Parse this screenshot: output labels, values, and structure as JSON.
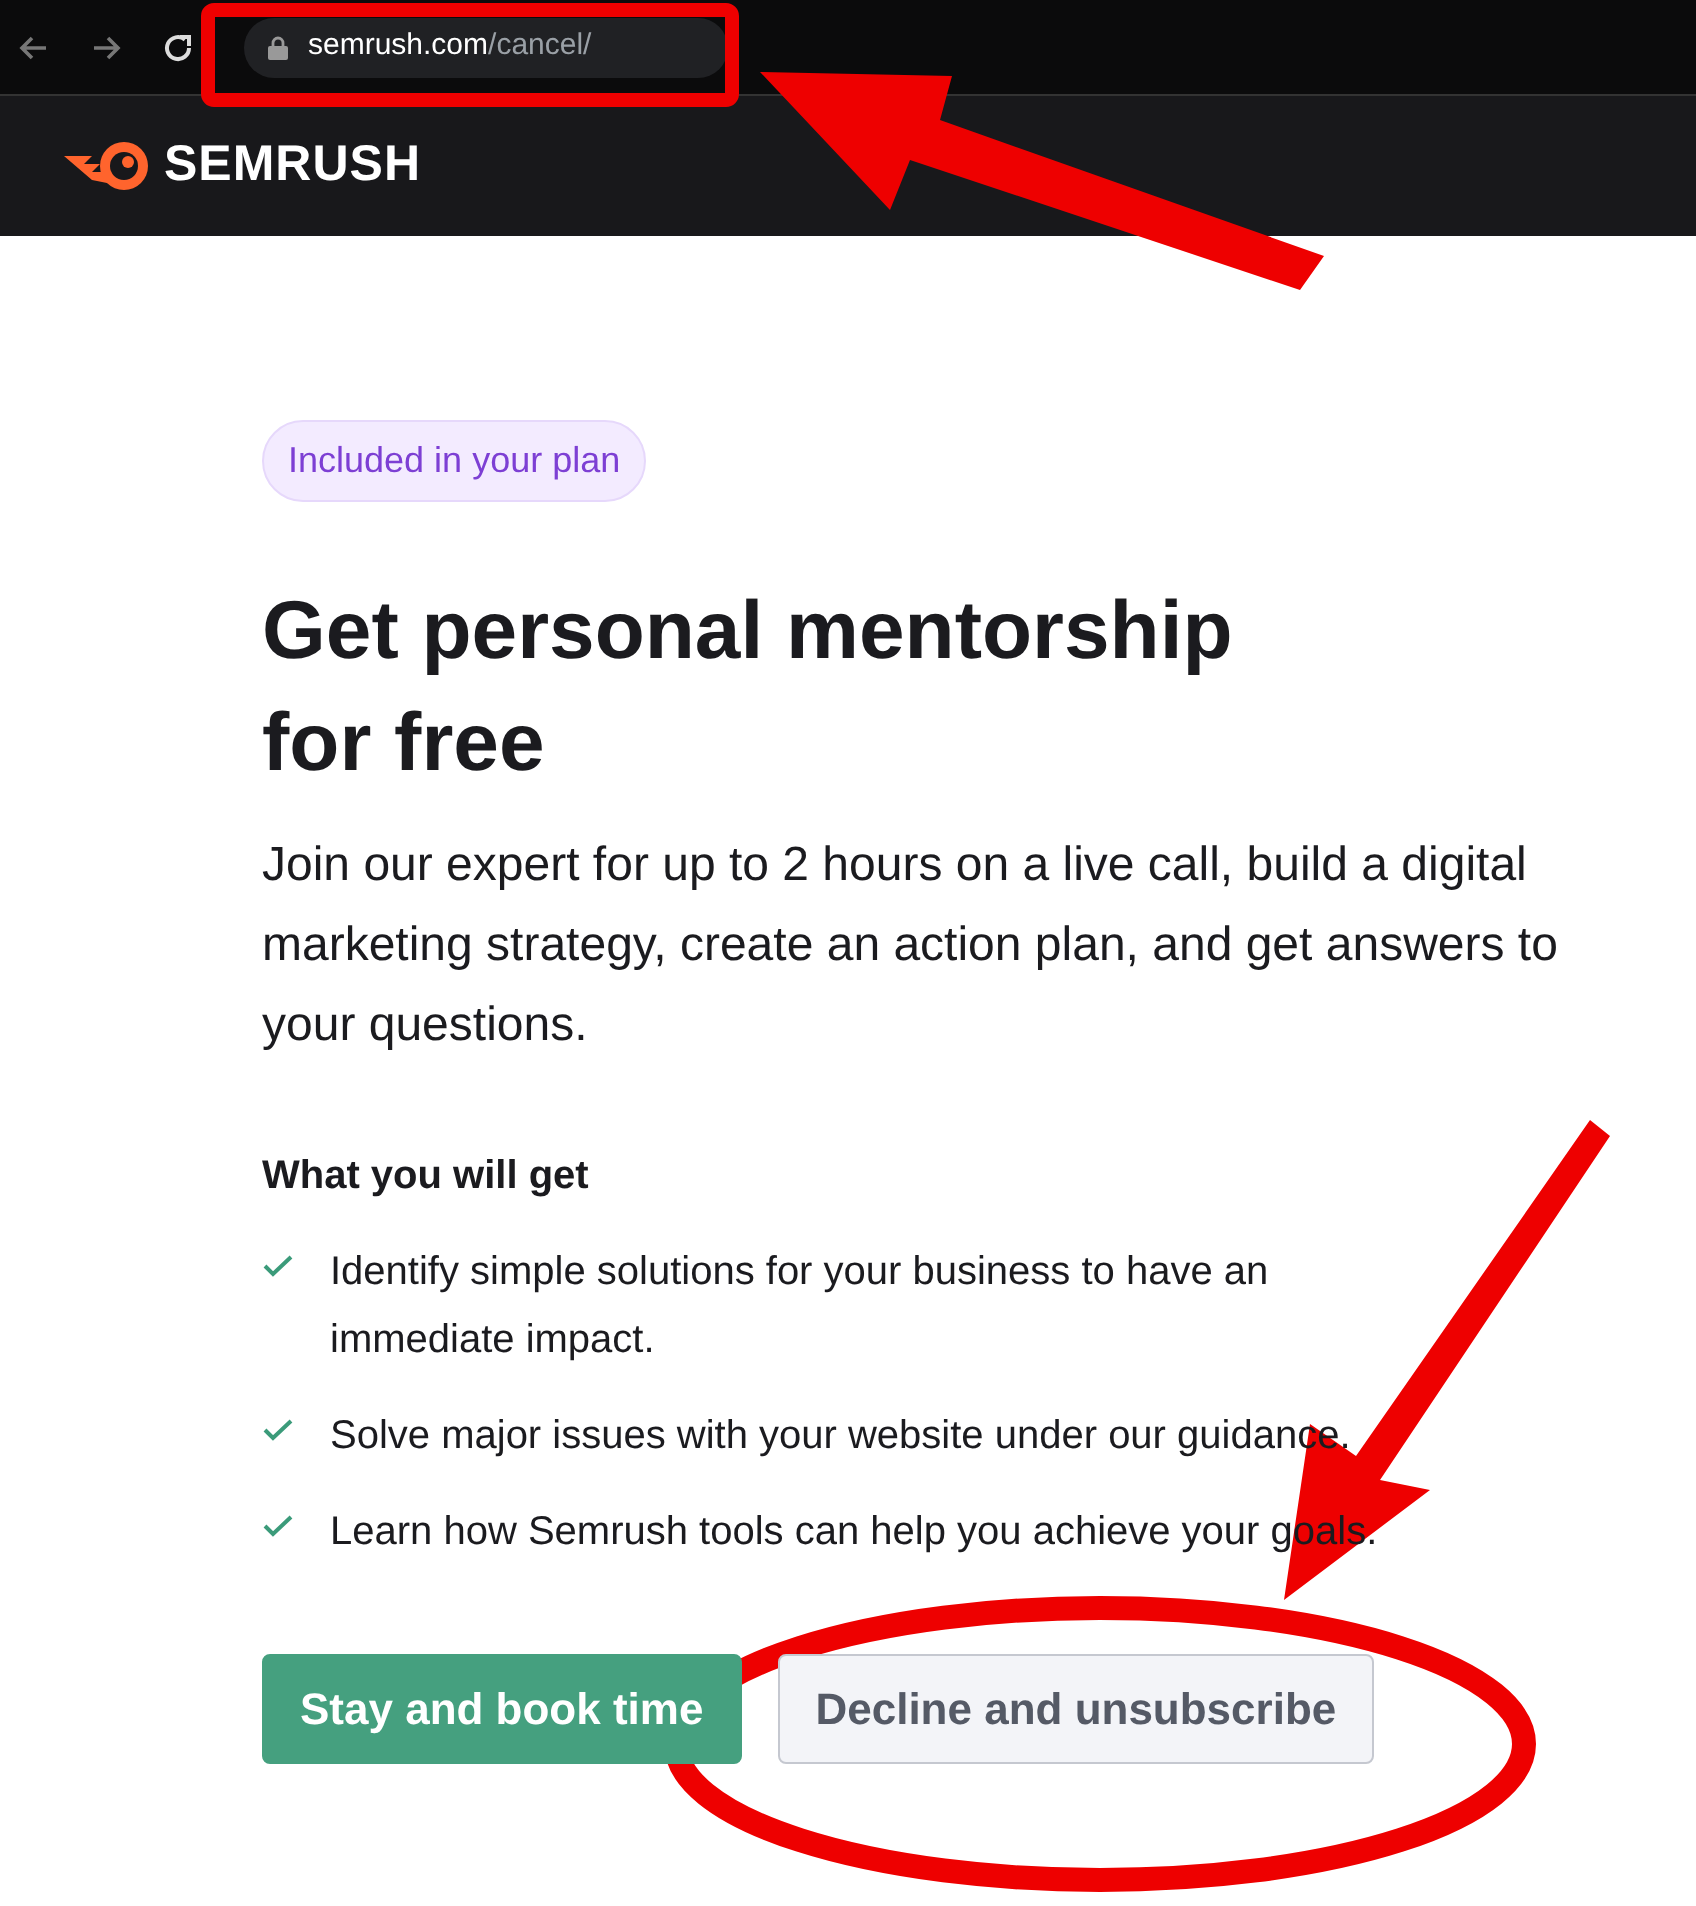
{
  "browser": {
    "url_host": "semrush.com",
    "url_path": "/cancel/"
  },
  "header": {
    "logo_text": "SEMRUSH"
  },
  "badge": "Included in your plan",
  "title": [
    "Get personal mentorship",
    "for free"
  ],
  "description": "Join our expert for up to 2 hours on a live call, build a digital marketing strategy, create an action plan, and get answers to your questions.",
  "benefits_heading": "What you will get",
  "benefits": [
    "Identify simple solutions for your business to have an immediate impact.",
    "Solve major issues with your website under our guidance.",
    "Learn how Semrush tools can help you achieve your goals."
  ],
  "buttons": [
    {
      "label": "Stay and book time",
      "kind": "primary"
    },
    {
      "label": "Decline and unsubscribe",
      "kind": "secondary"
    }
  ]
}
